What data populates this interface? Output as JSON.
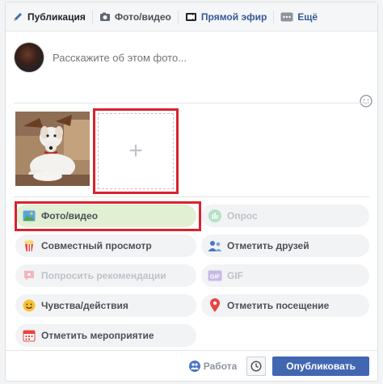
{
  "tabs": [
    {
      "label": "Публикация",
      "icon": "pencil-icon"
    },
    {
      "label": "Фото/видео",
      "icon": "camera-icon"
    },
    {
      "label": "Прямой эфир",
      "icon": "video-camera-icon"
    },
    {
      "label": "Ещё",
      "icon": "more-icon"
    }
  ],
  "composer": {
    "placeholder": "Расскажите об этом фото..."
  },
  "media": {
    "add_symbol": "+"
  },
  "options": [
    {
      "label": "Фото/видео",
      "icon": "photo-icon",
      "enabled": true
    },
    {
      "label": "Опрос",
      "icon": "poll-icon",
      "enabled": false
    },
    {
      "label": "Совместный просмотр",
      "icon": "popcorn-icon",
      "enabled": true
    },
    {
      "label": "Отметить друзей",
      "icon": "tag-people-icon",
      "enabled": true
    },
    {
      "label": "Попросить рекомендации",
      "icon": "recommendation-icon",
      "enabled": false
    },
    {
      "label": "GIF",
      "icon": "gif-icon",
      "enabled": false
    },
    {
      "label": "Чувства/действия",
      "icon": "smiley-icon",
      "enabled": true
    },
    {
      "label": "Отметить посещение",
      "icon": "location-pin-icon",
      "enabled": true
    },
    {
      "label": "Отметить мероприятие",
      "icon": "calendar-icon",
      "enabled": true
    }
  ],
  "footer": {
    "audience": "Работа",
    "publish": "Опубликовать"
  },
  "colors": {
    "accent": "#4267b2",
    "highlight_border": "#d9232e",
    "selected_bg": "#e1efd3"
  }
}
